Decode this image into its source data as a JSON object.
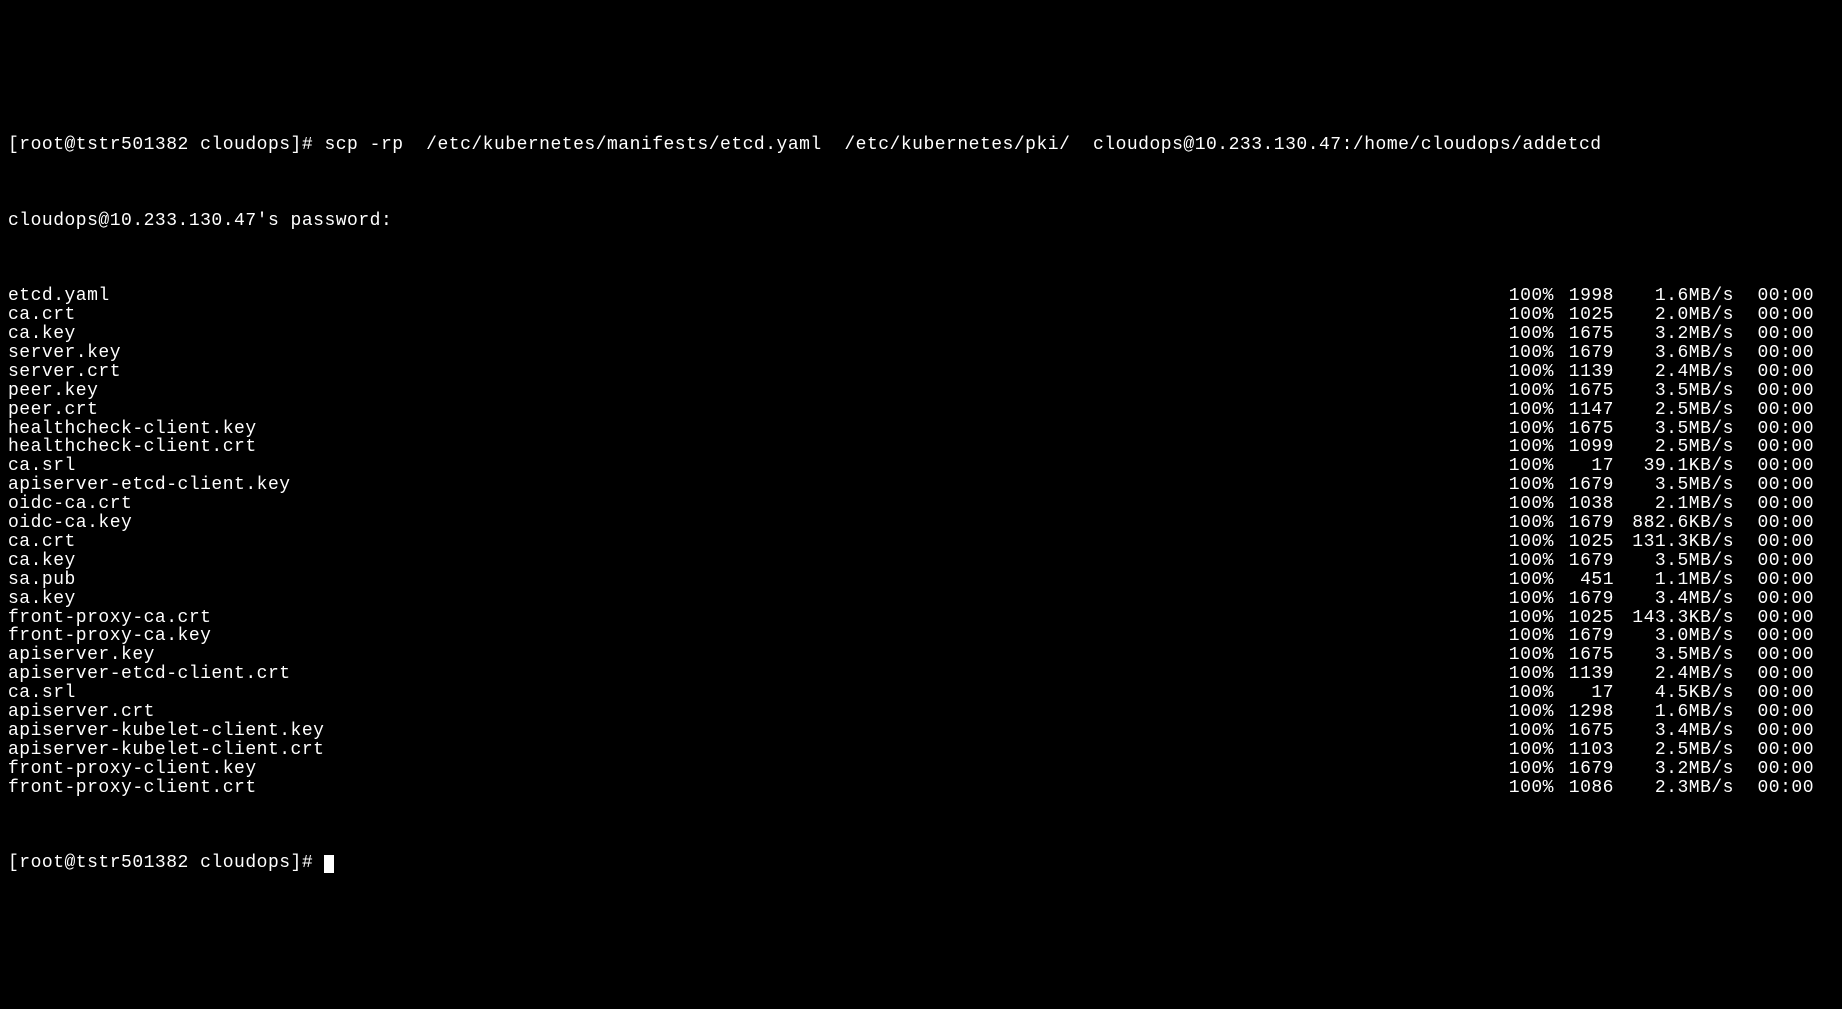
{
  "prompt1": {
    "user_host": "[root@tstr501382 cloudops]# ",
    "cmd": "scp -rp  /etc/kubernetes/manifests/etcd.yaml  /etc/kubernetes/pki/  cloudops@10.233.130.47:/home/cloudops/addetcd"
  },
  "password_line": "cloudops@10.233.130.47's password:",
  "files": [
    {
      "name": "etcd.yaml",
      "pct": "100%",
      "size": "1998",
      "rate": "1.6MB/s",
      "time": "00:00"
    },
    {
      "name": "ca.crt",
      "pct": "100%",
      "size": "1025",
      "rate": "2.0MB/s",
      "time": "00:00"
    },
    {
      "name": "ca.key",
      "pct": "100%",
      "size": "1675",
      "rate": "3.2MB/s",
      "time": "00:00"
    },
    {
      "name": "server.key",
      "pct": "100%",
      "size": "1679",
      "rate": "3.6MB/s",
      "time": "00:00"
    },
    {
      "name": "server.crt",
      "pct": "100%",
      "size": "1139",
      "rate": "2.4MB/s",
      "time": "00:00"
    },
    {
      "name": "peer.key",
      "pct": "100%",
      "size": "1675",
      "rate": "3.5MB/s",
      "time": "00:00"
    },
    {
      "name": "peer.crt",
      "pct": "100%",
      "size": "1147",
      "rate": "2.5MB/s",
      "time": "00:00"
    },
    {
      "name": "healthcheck-client.key",
      "pct": "100%",
      "size": "1675",
      "rate": "3.5MB/s",
      "time": "00:00"
    },
    {
      "name": "healthcheck-client.crt",
      "pct": "100%",
      "size": "1099",
      "rate": "2.5MB/s",
      "time": "00:00"
    },
    {
      "name": "ca.srl",
      "pct": "100%",
      "size": "17",
      "rate": "39.1KB/s",
      "time": "00:00"
    },
    {
      "name": "apiserver-etcd-client.key",
      "pct": "100%",
      "size": "1679",
      "rate": "3.5MB/s",
      "time": "00:00"
    },
    {
      "name": "oidc-ca.crt",
      "pct": "100%",
      "size": "1038",
      "rate": "2.1MB/s",
      "time": "00:00"
    },
    {
      "name": "oidc-ca.key",
      "pct": "100%",
      "size": "1679",
      "rate": "882.6KB/s",
      "time": "00:00"
    },
    {
      "name": "ca.crt",
      "pct": "100%",
      "size": "1025",
      "rate": "131.3KB/s",
      "time": "00:00"
    },
    {
      "name": "ca.key",
      "pct": "100%",
      "size": "1679",
      "rate": "3.5MB/s",
      "time": "00:00"
    },
    {
      "name": "sa.pub",
      "pct": "100%",
      "size": "451",
      "rate": "1.1MB/s",
      "time": "00:00"
    },
    {
      "name": "sa.key",
      "pct": "100%",
      "size": "1679",
      "rate": "3.4MB/s",
      "time": "00:00"
    },
    {
      "name": "front-proxy-ca.crt",
      "pct": "100%",
      "size": "1025",
      "rate": "143.3KB/s",
      "time": "00:00"
    },
    {
      "name": "front-proxy-ca.key",
      "pct": "100%",
      "size": "1679",
      "rate": "3.0MB/s",
      "time": "00:00"
    },
    {
      "name": "apiserver.key",
      "pct": "100%",
      "size": "1675",
      "rate": "3.5MB/s",
      "time": "00:00"
    },
    {
      "name": "apiserver-etcd-client.crt",
      "pct": "100%",
      "size": "1139",
      "rate": "2.4MB/s",
      "time": "00:00"
    },
    {
      "name": "ca.srl",
      "pct": "100%",
      "size": "17",
      "rate": "4.5KB/s",
      "time": "00:00"
    },
    {
      "name": "apiserver.crt",
      "pct": "100%",
      "size": "1298",
      "rate": "1.6MB/s",
      "time": "00:00"
    },
    {
      "name": "apiserver-kubelet-client.key",
      "pct": "100%",
      "size": "1675",
      "rate": "3.4MB/s",
      "time": "00:00"
    },
    {
      "name": "apiserver-kubelet-client.crt",
      "pct": "100%",
      "size": "1103",
      "rate": "2.5MB/s",
      "time": "00:00"
    },
    {
      "name": "front-proxy-client.key",
      "pct": "100%",
      "size": "1679",
      "rate": "3.2MB/s",
      "time": "00:00"
    },
    {
      "name": "front-proxy-client.crt",
      "pct": "100%",
      "size": "1086",
      "rate": "2.3MB/s",
      "time": "00:00"
    }
  ],
  "prompt2": "[root@tstr501382 cloudops]# "
}
